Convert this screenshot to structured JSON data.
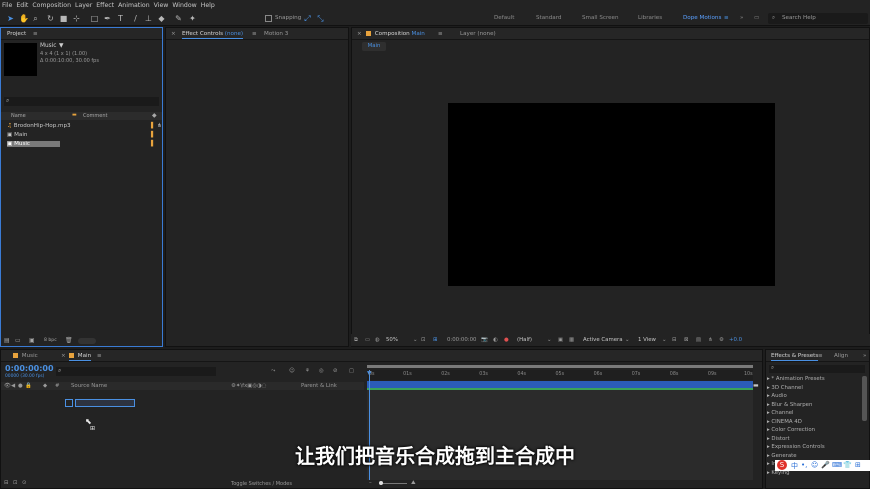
{
  "menu": [
    "File",
    "Edit",
    "Composition",
    "Layer",
    "Effect",
    "Animation",
    "View",
    "Window",
    "Help"
  ],
  "toolbar": {
    "snapping_label": "Snapping",
    "workspaces": [
      "Default",
      "Standard",
      "Small Screen",
      "Libraries",
      "Dope Motions"
    ],
    "active_workspace": "Dope Motions",
    "search_placeholder": "Search Help"
  },
  "project": {
    "tab": "Project",
    "item_name": "Music",
    "item_info1": "4 x 4  (1 x 1) (1.00)",
    "item_info2": "Δ 0:00:10:00, 30.00 fps",
    "columns": {
      "name": "Name",
      "comment": "Comment"
    },
    "items": [
      {
        "name": "BrodonHip-Hop.mp3",
        "type": "audio"
      },
      {
        "name": "Main",
        "type": "comp"
      },
      {
        "name": "Music",
        "type": "comp",
        "selected": true
      }
    ],
    "bpc": "8 bpc"
  },
  "effect_controls": {
    "tab_prefix": "Effect Controls",
    "tab_value": "(none)",
    "tab2": "Motion 3"
  },
  "composition": {
    "tab_prefix": "Composition",
    "tab_value": "Main",
    "layer_tab_prefix": "Layer",
    "layer_tab_value": "(none)",
    "sub_tab": "Main",
    "zoom": "50%",
    "timecode": "0:00:00:00",
    "resolution": "(Half)",
    "camera": "Active Camera",
    "views": "1 View",
    "exposure": "+0.0"
  },
  "timeline": {
    "tabs": [
      "Music",
      "Main"
    ],
    "active_tab": "Main",
    "current_time": "0:00:00:00",
    "frame_info": "00000 (30.00 fps)",
    "col_source": "Source Name",
    "col_parent": "Parent & Link",
    "ruler_labels": [
      "0s",
      "01s",
      "02s",
      "03s",
      "04s",
      "05s",
      "06s",
      "07s",
      "08s",
      "09s",
      "10s"
    ],
    "toggle_label": "Toggle Switches / Modes"
  },
  "effects_presets": {
    "tabs": [
      "Effects & Presets",
      "Align"
    ],
    "items": [
      "* Animation Presets",
      "3D Channel",
      "Audio",
      "Blur & Sharpen",
      "Channel",
      "CINEMA 4D",
      "Color Correction",
      "Distort",
      "Expression Controls",
      "Generate",
      "Immersive Video",
      "Keying"
    ]
  },
  "ime_bar": {
    "label": "中"
  },
  "subtitle": "让我们把音乐合成拖到主合成中",
  "colors": {
    "accent": "#4a90e2",
    "label_orange": "#e8a33d",
    "workspace_active": "#5aa0ff"
  }
}
